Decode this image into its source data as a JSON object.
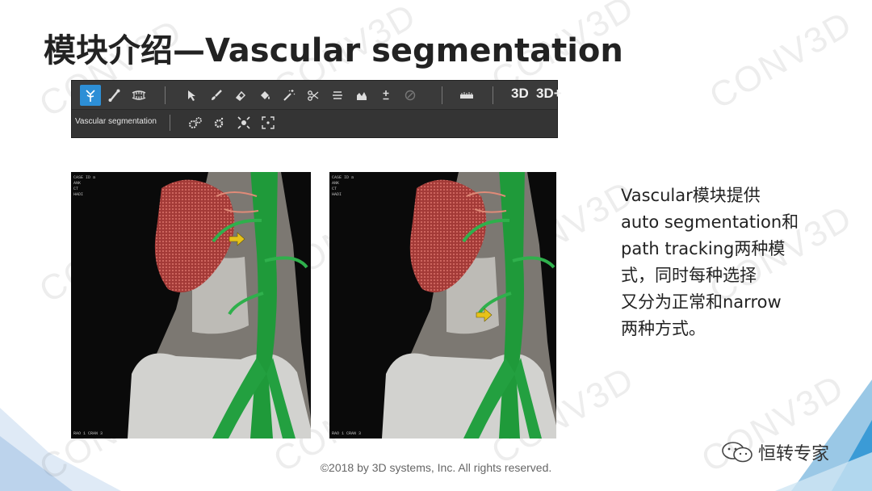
{
  "slide": {
    "title": "模块介绍—Vascular segmentation",
    "watermark": "CONV3D",
    "copyright": "©2018 by 3D systems, Inc.  All rights reserved.",
    "brand": "恒转专家"
  },
  "toolbar": {
    "row1": {
      "tools": [
        {
          "icon": "vessel-tree-icon",
          "active": true
        },
        {
          "icon": "bone-icon",
          "active": false
        },
        {
          "icon": "teeth-icon",
          "active": false
        },
        {
          "icon": "select-arrow-icon",
          "active": false
        },
        {
          "icon": "brush-icon",
          "active": false
        },
        {
          "icon": "eraser-icon",
          "active": false
        },
        {
          "icon": "fill-bucket-icon",
          "active": false
        },
        {
          "icon": "magic-wand-icon",
          "active": false
        },
        {
          "icon": "scissors-icon",
          "active": false
        },
        {
          "icon": "threshold-icon",
          "active": false
        },
        {
          "icon": "histogram-icon",
          "active": false
        },
        {
          "icon": "plus-minus-icon",
          "active": false
        },
        {
          "icon": "disabled-tool-icon",
          "active": false
        },
        {
          "icon": "ruler-icon",
          "active": false
        }
      ],
      "label_3d": "3D",
      "label_3d_plus": "3D+"
    },
    "row2": {
      "mode_label": "Vascular segmentation",
      "tools": [
        {
          "icon": "gears-settings-icon"
        },
        {
          "icon": "gear-icon"
        },
        {
          "icon": "focus-points-icon"
        },
        {
          "icon": "expand-points-icon"
        }
      ]
    }
  },
  "images": {
    "left": {
      "corner_top": "CASE ID a\nANK\nCT\nHADI",
      "corner_bottom": "RAO 1  CRAN 3"
    },
    "right": {
      "corner_top": "CASE ID a\nANK\nCT\nHADI",
      "corner_bottom": "RAO 1  CRAN 3"
    }
  },
  "description": {
    "lines": [
      "Vascular模块提供",
      "auto segmentation和",
      "path tracking两种模",
      "式，同时每种选择",
      "又分为正常和narrow",
      "两种方式。"
    ]
  },
  "colors": {
    "accent_blue": "#2d8fd6",
    "toolbar_bg": "#3a3a3a",
    "vessel_green": "#1f9a3a",
    "kidney_red": "#b8423f",
    "bone_gray": "#cfcfcf",
    "arrow_yellow": "#e6c21a"
  }
}
